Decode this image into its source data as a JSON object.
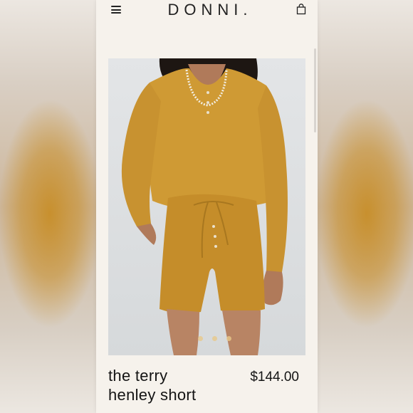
{
  "header": {
    "brand": "DONNI.",
    "menu_icon": "hamburger-menu-icon",
    "bag_icon": "shopping-bag-icon"
  },
  "product": {
    "name_line1": "the terry",
    "name_line2": "henley short",
    "price": "$144.00",
    "image_alt": "Model wearing mustard terry henley top and shorts",
    "carousel": {
      "total": 3,
      "active": 1
    }
  },
  "colors": {
    "accent": "#c8902e",
    "page_bg": "#f6f2ec",
    "text": "#141414"
  }
}
